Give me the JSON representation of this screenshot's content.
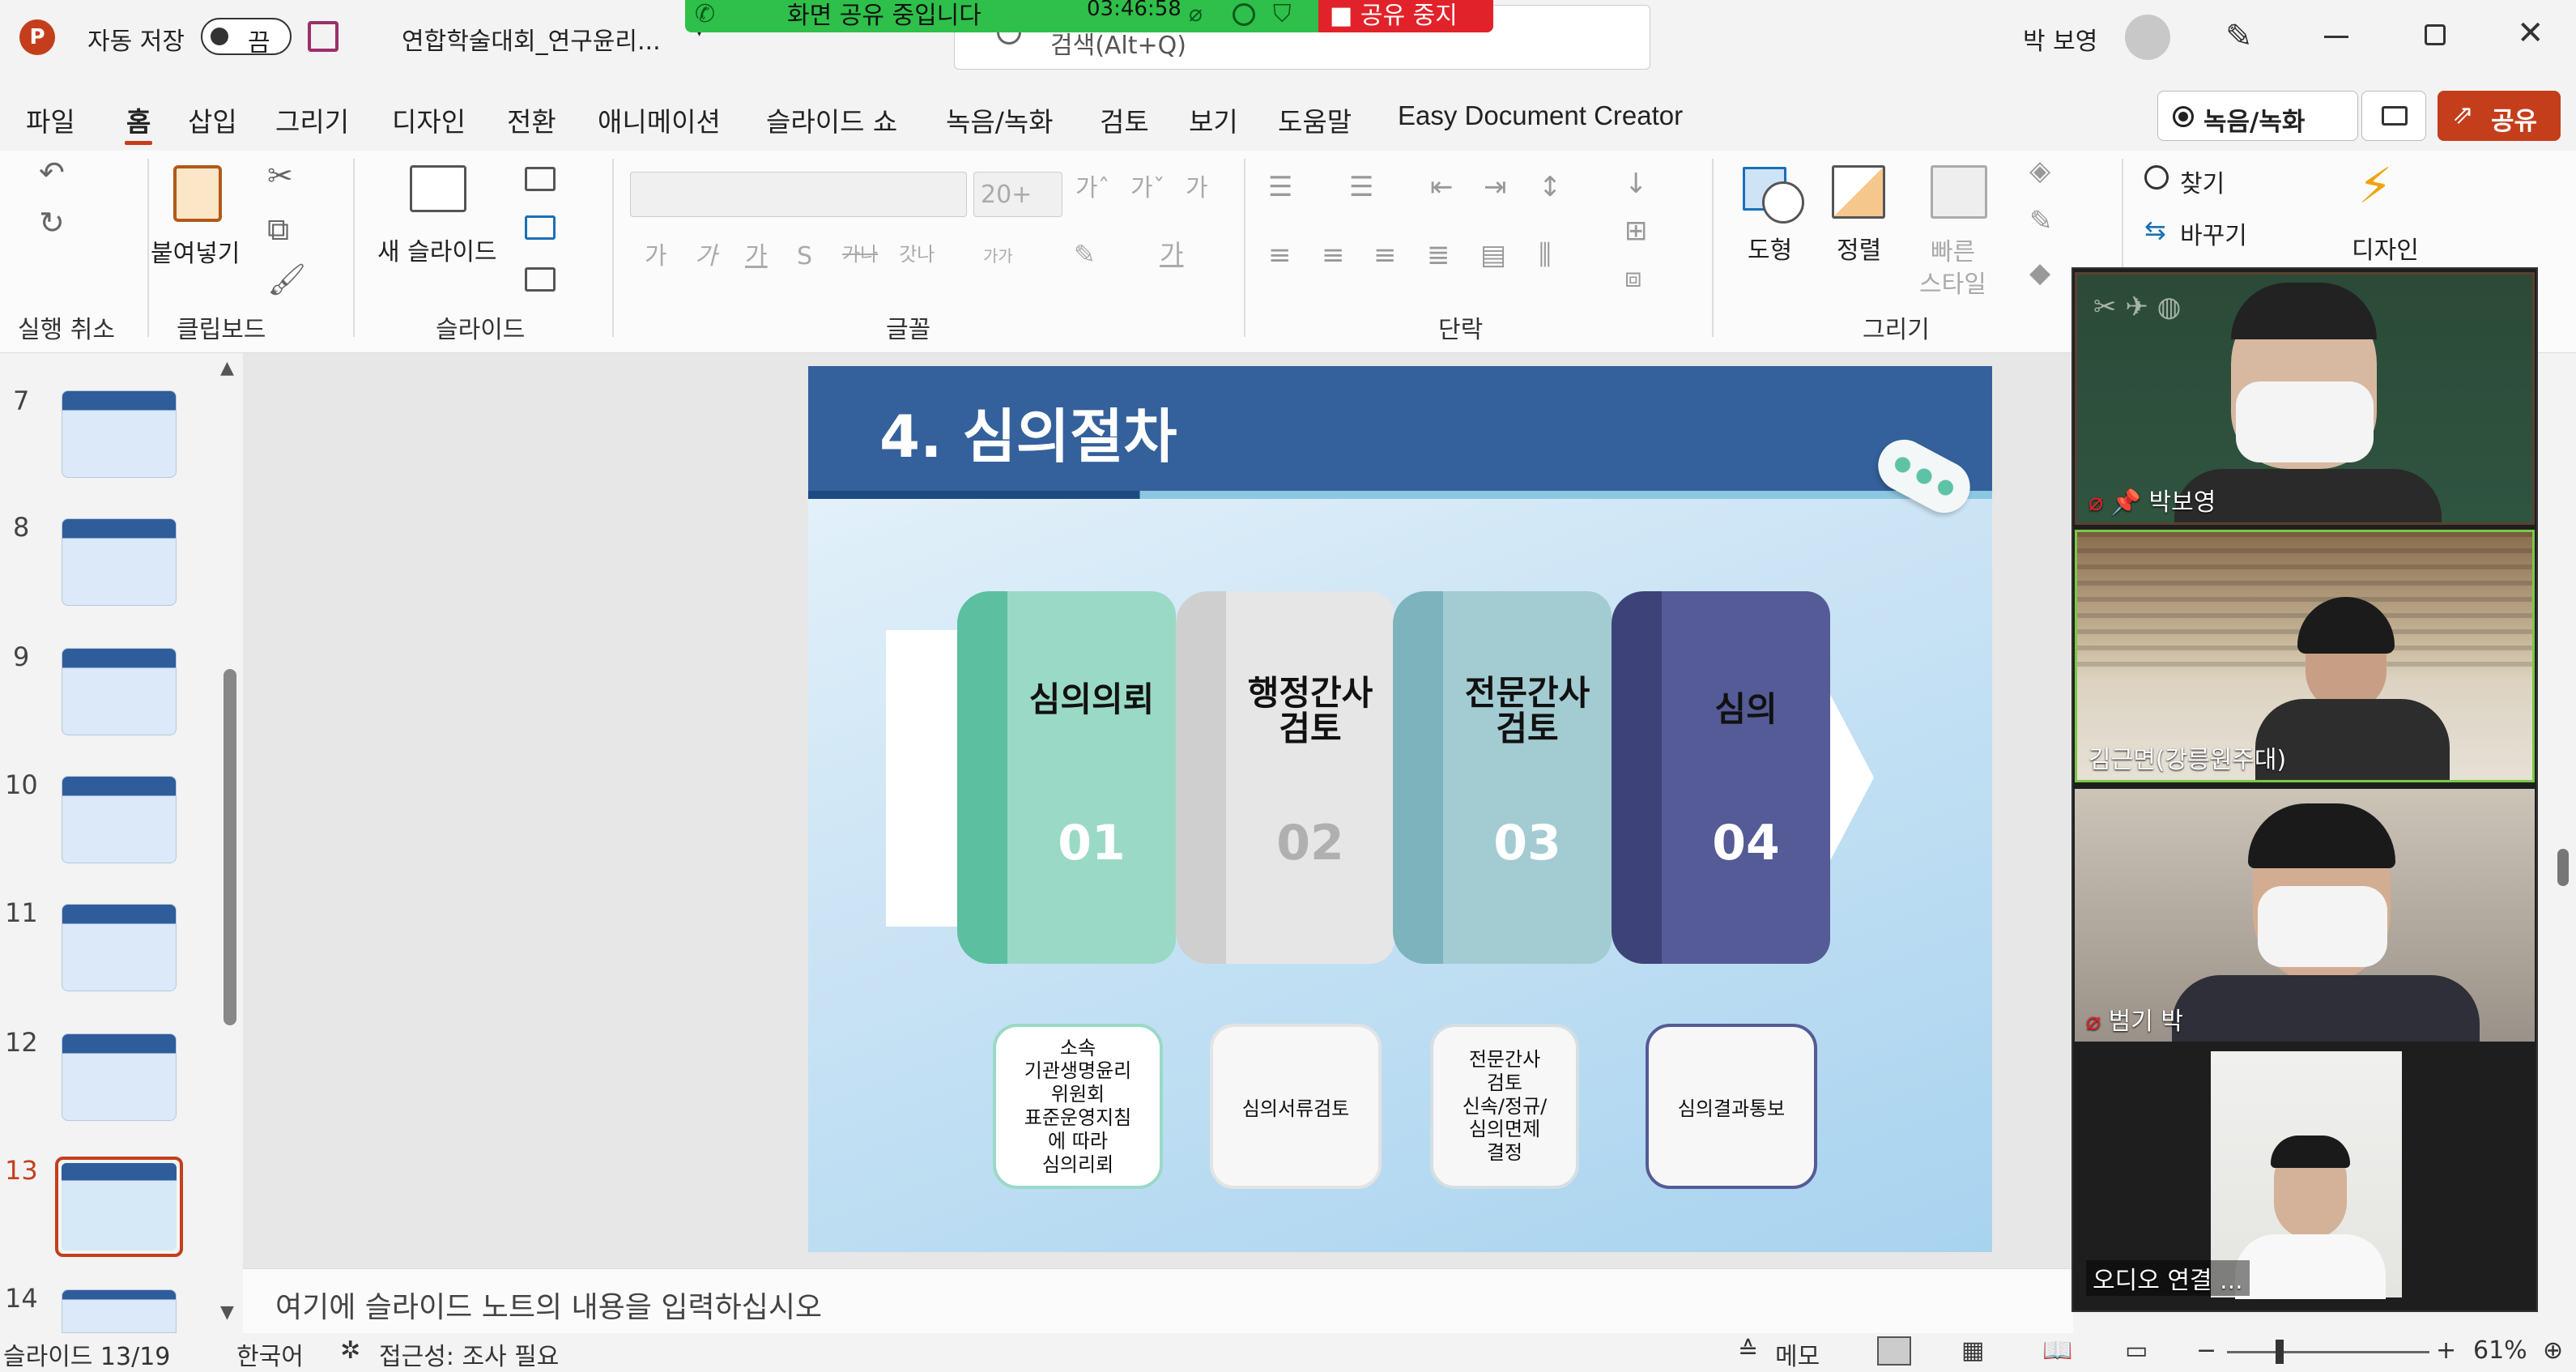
{
  "titlebar": {
    "autosave_label": "자동 저장",
    "autosave_state": "끔",
    "doc_title": "연합학술대회_연구윤리...",
    "search_placeholder": "검색(Alt+Q)",
    "user_name": "박 보영"
  },
  "share_banner": {
    "text": "화면 공유 중입니다",
    "time": "03:46:58",
    "stop_label": "공유 중지"
  },
  "menu": {
    "items": [
      "파일",
      "홈",
      "삽입",
      "그리기",
      "디자인",
      "전환",
      "애니메이션",
      "슬라이드 쇼",
      "녹음/녹화",
      "검토",
      "보기",
      "도움말",
      "Easy Document Creator"
    ],
    "record_button": "녹음/녹화",
    "share_button": "공유"
  },
  "ribbon": {
    "groups": [
      "실행 취소",
      "클립보드",
      "슬라이드",
      "글꼴",
      "단락",
      "그리기"
    ],
    "paste_label": "붙여넣기",
    "new_slide_label": "새 슬라이드",
    "font_size": "20+",
    "shapes_label": "도형",
    "arrange_label": "정렬",
    "quick_styles_label": [
      "빠른",
      "스타일"
    ],
    "find_label": "찾기",
    "replace_label": "바꾸기",
    "designer_label": "디자인"
  },
  "thumbnails": [
    7,
    8,
    9,
    10,
    11,
    12,
    13,
    14
  ],
  "current_slide_index": 13,
  "slide": {
    "title": "4. 심의절차",
    "steps": [
      {
        "label": "심의의뢰",
        "num": "01",
        "color": "#9ad9c5",
        "dark": "#5cbf9f",
        "numcolor": "#ffffff"
      },
      {
        "label": "행정간사\n검토",
        "num": "02",
        "color": "#e6e6e6",
        "dark": "#c9c9c9",
        "numcolor": "#b0b0b0"
      },
      {
        "label": "전문간사\n검토",
        "num": "03",
        "color": "#a3cbd2",
        "dark": "#7db3bd",
        "numcolor": "#ffffff"
      },
      {
        "label": "심의",
        "num": "04",
        "color": "#555b96",
        "dark": "#3d4279",
        "numcolor": "#ffffff"
      }
    ],
    "boxes": [
      {
        "text": "소속\n기관생명윤리\n위원회\n표준운영지침\n에 따라\n심의리뢰",
        "border": "#9ad9c5"
      },
      {
        "text": "심의서류검토",
        "border": "#e3e3e3"
      },
      {
        "text": "전문간사\n검토\n신속/정규/\n심의면제\n결정",
        "border": "#d4dfe2"
      },
      {
        "text": "심의결과통보",
        "border": "#555b96"
      }
    ]
  },
  "notes_placeholder": "여기에 슬라이드 노트의 내용을 입력하십시오",
  "status": {
    "slide_info": "슬라이드 13/19",
    "language": "한국어",
    "accessibility": "접근성: 조사 필요",
    "notes_label": "메모",
    "zoom": "61%"
  },
  "participants": [
    {
      "name": "박보영",
      "muted": true,
      "pinned": true
    },
    {
      "name": "김근면(강릉원주대)",
      "muted": false,
      "pinned": false
    },
    {
      "name": "범기 박",
      "muted": true,
      "pinned": false
    },
    {
      "name": "오디오 연결 ...",
      "muted": false,
      "pinned": false
    }
  ]
}
